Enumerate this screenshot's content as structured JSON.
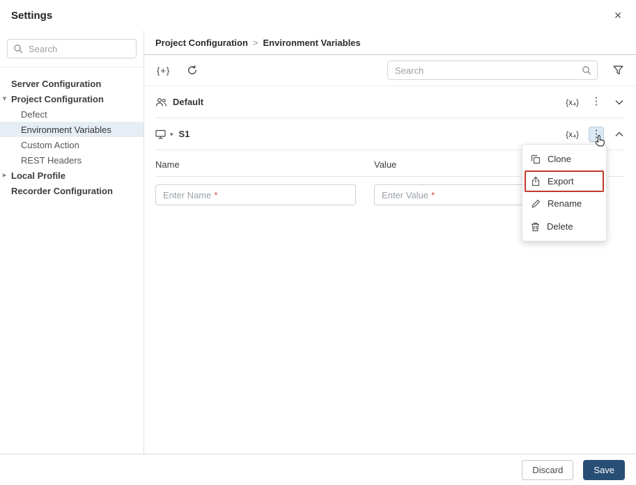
{
  "window": {
    "title": "Settings"
  },
  "icons": {
    "close": "✕",
    "kebab": "⋮",
    "braces_plus": "{+}",
    "variables_badge": "{x₄}",
    "caret_down": "▾",
    "tree_expanded": "▾",
    "tree_collapsed": "▸"
  },
  "sidebar": {
    "search_placeholder": "Search",
    "items": [
      {
        "label": "Server Configuration"
      },
      {
        "label": "Project Configuration",
        "expanded": true
      },
      {
        "label": "Defect"
      },
      {
        "label": "Environment Variables",
        "selected": true
      },
      {
        "label": "Custom Action"
      },
      {
        "label": "REST Headers"
      },
      {
        "label": "Local Profile",
        "collapsed": true
      },
      {
        "label": "Recorder Configuration"
      }
    ]
  },
  "breadcrumb": {
    "items": [
      "Project Configuration",
      "Environment Variables"
    ],
    "separator": ">"
  },
  "toolbar": {
    "search_placeholder": "Search"
  },
  "sections": [
    {
      "name": "Default",
      "icon": "group-icon",
      "state": "collapsed"
    },
    {
      "name": "S1",
      "icon": "monitor-icon",
      "state": "expanded"
    }
  ],
  "table": {
    "headers": [
      "Name",
      "Value"
    ],
    "name_placeholder": "Enter Name",
    "value_placeholder": "Enter Value",
    "required_mark": "*"
  },
  "context_menu": {
    "items": [
      {
        "label": "Clone",
        "icon": "clone-icon"
      },
      {
        "label": "Export",
        "icon": "export-icon",
        "highlighted": true
      },
      {
        "label": "Rename",
        "icon": "rename-icon"
      },
      {
        "label": "Delete",
        "icon": "delete-icon"
      }
    ]
  },
  "footer": {
    "discard": "Discard",
    "save": "Save"
  },
  "colors": {
    "save_button": "#274e75",
    "selected_item_bg": "#e7edf4",
    "export_highlight": "#c0392b",
    "required_asterisk": "#e0443e",
    "kebab_active_bg": "#dce9f5"
  }
}
